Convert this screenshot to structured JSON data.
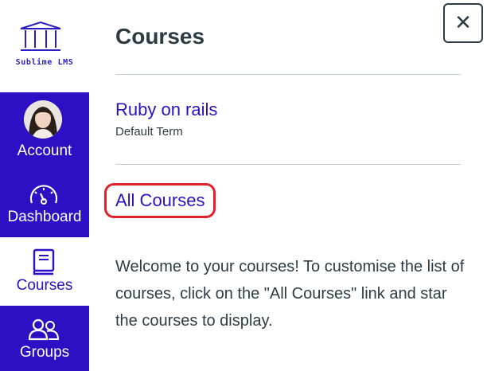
{
  "brand": {
    "logo_icon": "columns-building-icon",
    "logo_text": "Sublime LMS",
    "color": "#2a1ec0"
  },
  "nav": {
    "account_label": "Account",
    "dashboard_label": "Dashboard",
    "courses_label": "Courses",
    "groups_label": "Groups",
    "active": "Courses",
    "bg_color": "#2d0fc4"
  },
  "tray": {
    "title": "Courses",
    "close_icon": "close-icon",
    "courses": [
      {
        "name": "Ruby on rails",
        "term": "Default Term"
      }
    ],
    "all_courses_label": "All Courses",
    "highlight_color": "#e0202a",
    "welcome_text": "Welcome to your courses! To customise the list of courses, click on the \"All Courses\" link and star the courses to display."
  }
}
